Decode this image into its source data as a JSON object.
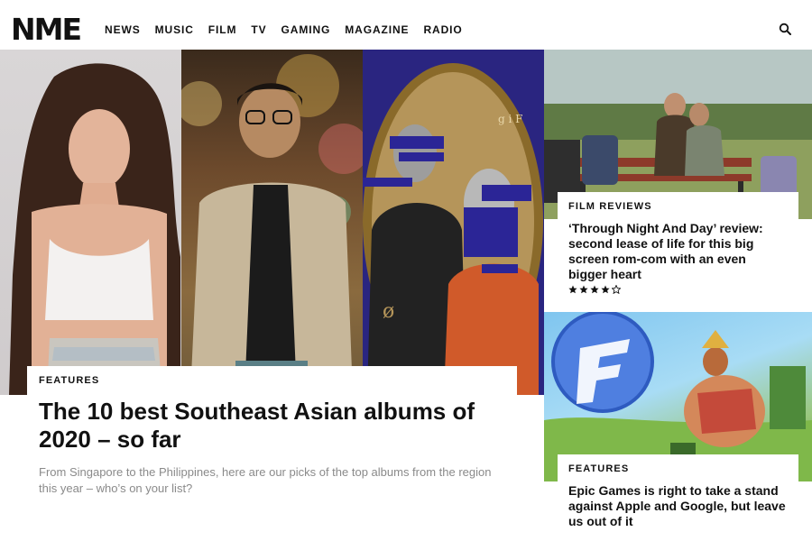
{
  "brand": {
    "logo_text": "NME"
  },
  "nav": {
    "items": [
      "NEWS",
      "MUSIC",
      "FILM",
      "TV",
      "GAMING",
      "MAGAZINE",
      "RADIO"
    ],
    "search_icon": "search-icon"
  },
  "hero": {
    "kicker": "FEATURES",
    "title": "The 10 best Southeast Asian albums of 2020 – so far",
    "subtitle": "From Singapore to the Philippines, here are our picks of the top albums from the region this year – who’s on your list?",
    "art_glyph": "ø",
    "art_letters": "g i F"
  },
  "side": [
    {
      "kicker": "FILM REVIEWS",
      "title": "‘Through Night And Day’ review: second lease of life for this big screen rom-com with an even bigger heart",
      "rating": 4,
      "rating_max": 5
    },
    {
      "kicker": "FEATURES",
      "title": "Epic Games is right to take a stand against Apple and Google, but leave us out of it"
    }
  ],
  "colors": {
    "text": "#111111",
    "muted": "#8a8a8a",
    "album_bg": "#2a2580",
    "glitch": "#2b2596"
  }
}
